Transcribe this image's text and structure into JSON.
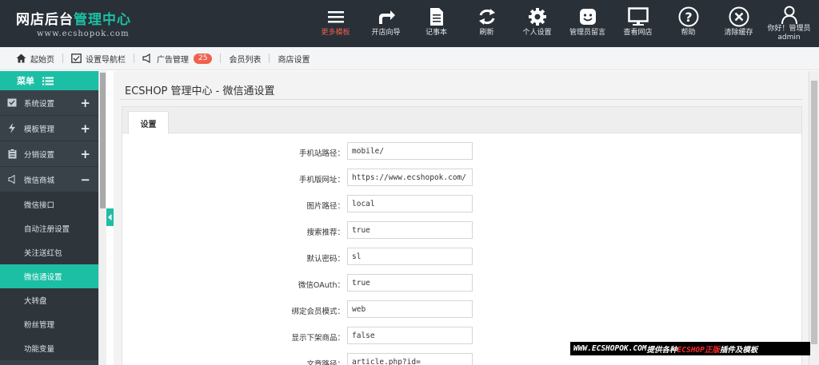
{
  "header": {
    "logo_title_part1": "网店后台",
    "logo_title_part2": "管理中心",
    "logo_subtitle": "www.ecshopok.com",
    "nav": [
      {
        "label": "更多模板",
        "icon": "menu-icon",
        "active": true
      },
      {
        "label": "开店向导",
        "icon": "share-arrow-icon"
      },
      {
        "label": "记事本",
        "icon": "notepad-icon"
      },
      {
        "label": "刷新",
        "icon": "refresh-icon"
      },
      {
        "label": "个人设置",
        "icon": "gear-icon"
      },
      {
        "label": "管理员留言",
        "icon": "smiley-message-icon"
      },
      {
        "label": "查看网店",
        "icon": "monitor-icon"
      },
      {
        "label": "帮助",
        "icon": "help-icon"
      },
      {
        "label": "清除缓存",
        "icon": "clear-cache-icon"
      },
      {
        "label": "你好！管理员",
        "label2": "admin",
        "icon": "user-icon"
      }
    ]
  },
  "subnav": {
    "items": [
      {
        "label": "起始页",
        "icon": "home-icon"
      },
      {
        "label": "设置导航栏",
        "icon": "navbar-settings-icon"
      },
      {
        "label": "广告管理",
        "icon": "megaphone-icon",
        "badge": "25"
      },
      {
        "label": "会员列表"
      },
      {
        "label": "商店设置"
      }
    ]
  },
  "sidebar": {
    "menu_label": "菜单",
    "groups": [
      {
        "label": "系统设置",
        "icon": "system-settings-icon",
        "toggle": "+"
      },
      {
        "label": "模板管理",
        "icon": "template-icon",
        "toggle": "+"
      },
      {
        "label": "分销设置",
        "icon": "distribution-icon",
        "toggle": "+"
      },
      {
        "label": "微信商城",
        "icon": "speaker-icon",
        "toggle": "−"
      }
    ],
    "sub_items": [
      {
        "label": "微信接口"
      },
      {
        "label": "自动注册设置"
      },
      {
        "label": "关注送红包"
      },
      {
        "label": "微信通设置",
        "active": true
      },
      {
        "label": "大转盘"
      },
      {
        "label": "粉丝管理"
      },
      {
        "label": "功能变量"
      }
    ]
  },
  "main": {
    "page_title": "ECSHOP 管理中心 - 微信通设置",
    "tab_label": "设置",
    "form": [
      {
        "label": "手机站路径：",
        "value": "mobile/"
      },
      {
        "label": "手机版网址：",
        "value": "https://www.ecshopok.com/"
      },
      {
        "label": "图片路径：",
        "value": "local"
      },
      {
        "label": "搜索推荐：",
        "value": "true"
      },
      {
        "label": "默认密码：",
        "value": "sl"
      },
      {
        "label": "微信OAuth：",
        "value": "true"
      },
      {
        "label": "绑定会员模式：",
        "value": "web"
      },
      {
        "label": "显示下架商品：",
        "value": "false"
      },
      {
        "label": "文章路径：",
        "value": "article.php?id="
      }
    ]
  },
  "watermark": {
    "part1": "WWW.ECSHOPOK.COM ",
    "part2": "提供各种",
    "part3": "ECSHOP正版",
    "part4": "插件及模板"
  },
  "colors": {
    "header_bg": "#293038",
    "accent": "#1cbfa4",
    "sidebar_bg": "#394249",
    "active_nav_label": "#f05a4f",
    "badge": "#f0614e"
  }
}
